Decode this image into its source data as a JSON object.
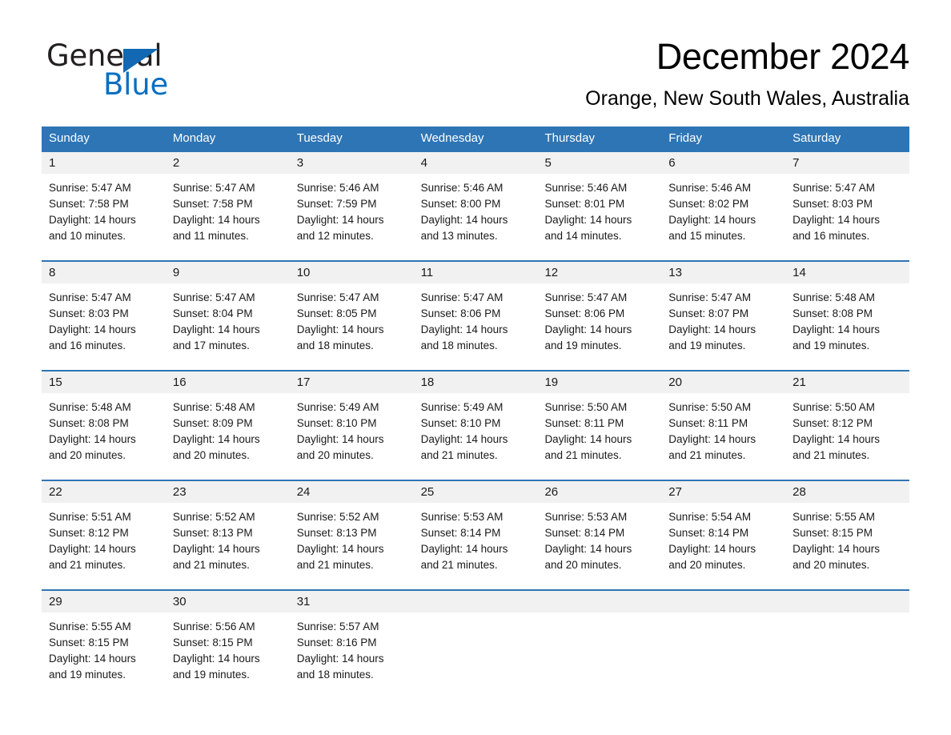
{
  "brand": {
    "name_part1": "General",
    "name_part2": "Blue",
    "triangle_color": "#1268b3",
    "blue_text_color": "#0b6fc0"
  },
  "header": {
    "month_title": "December 2024",
    "location": "Orange, New South Wales, Australia"
  },
  "theme": {
    "header_blue": "#2e75b5",
    "day_band_gray": "#f1f1f1",
    "text_dark": "#1a1a1a"
  },
  "weekdays": [
    "Sunday",
    "Monday",
    "Tuesday",
    "Wednesday",
    "Thursday",
    "Friday",
    "Saturday"
  ],
  "weeks": [
    [
      {
        "day": "1",
        "text": "Sunrise: 5:47 AM\nSunset: 7:58 PM\nDaylight: 14 hours\nand 10 minutes."
      },
      {
        "day": "2",
        "text": "Sunrise: 5:47 AM\nSunset: 7:58 PM\nDaylight: 14 hours\nand 11 minutes."
      },
      {
        "day": "3",
        "text": "Sunrise: 5:46 AM\nSunset: 7:59 PM\nDaylight: 14 hours\nand 12 minutes."
      },
      {
        "day": "4",
        "text": "Sunrise: 5:46 AM\nSunset: 8:00 PM\nDaylight: 14 hours\nand 13 minutes."
      },
      {
        "day": "5",
        "text": "Sunrise: 5:46 AM\nSunset: 8:01 PM\nDaylight: 14 hours\nand 14 minutes."
      },
      {
        "day": "6",
        "text": "Sunrise: 5:46 AM\nSunset: 8:02 PM\nDaylight: 14 hours\nand 15 minutes."
      },
      {
        "day": "7",
        "text": "Sunrise: 5:47 AM\nSunset: 8:03 PM\nDaylight: 14 hours\nand 16 minutes."
      }
    ],
    [
      {
        "day": "8",
        "text": "Sunrise: 5:47 AM\nSunset: 8:03 PM\nDaylight: 14 hours\nand 16 minutes."
      },
      {
        "day": "9",
        "text": "Sunrise: 5:47 AM\nSunset: 8:04 PM\nDaylight: 14 hours\nand 17 minutes."
      },
      {
        "day": "10",
        "text": "Sunrise: 5:47 AM\nSunset: 8:05 PM\nDaylight: 14 hours\nand 18 minutes."
      },
      {
        "day": "11",
        "text": "Sunrise: 5:47 AM\nSunset: 8:06 PM\nDaylight: 14 hours\nand 18 minutes."
      },
      {
        "day": "12",
        "text": "Sunrise: 5:47 AM\nSunset: 8:06 PM\nDaylight: 14 hours\nand 19 minutes."
      },
      {
        "day": "13",
        "text": "Sunrise: 5:47 AM\nSunset: 8:07 PM\nDaylight: 14 hours\nand 19 minutes."
      },
      {
        "day": "14",
        "text": "Sunrise: 5:48 AM\nSunset: 8:08 PM\nDaylight: 14 hours\nand 19 minutes."
      }
    ],
    [
      {
        "day": "15",
        "text": "Sunrise: 5:48 AM\nSunset: 8:08 PM\nDaylight: 14 hours\nand 20 minutes."
      },
      {
        "day": "16",
        "text": "Sunrise: 5:48 AM\nSunset: 8:09 PM\nDaylight: 14 hours\nand 20 minutes."
      },
      {
        "day": "17",
        "text": "Sunrise: 5:49 AM\nSunset: 8:10 PM\nDaylight: 14 hours\nand 20 minutes."
      },
      {
        "day": "18",
        "text": "Sunrise: 5:49 AM\nSunset: 8:10 PM\nDaylight: 14 hours\nand 21 minutes."
      },
      {
        "day": "19",
        "text": "Sunrise: 5:50 AM\nSunset: 8:11 PM\nDaylight: 14 hours\nand 21 minutes."
      },
      {
        "day": "20",
        "text": "Sunrise: 5:50 AM\nSunset: 8:11 PM\nDaylight: 14 hours\nand 21 minutes."
      },
      {
        "day": "21",
        "text": "Sunrise: 5:50 AM\nSunset: 8:12 PM\nDaylight: 14 hours\nand 21 minutes."
      }
    ],
    [
      {
        "day": "22",
        "text": "Sunrise: 5:51 AM\nSunset: 8:12 PM\nDaylight: 14 hours\nand 21 minutes."
      },
      {
        "day": "23",
        "text": "Sunrise: 5:52 AM\nSunset: 8:13 PM\nDaylight: 14 hours\nand 21 minutes."
      },
      {
        "day": "24",
        "text": "Sunrise: 5:52 AM\nSunset: 8:13 PM\nDaylight: 14 hours\nand 21 minutes."
      },
      {
        "day": "25",
        "text": "Sunrise: 5:53 AM\nSunset: 8:14 PM\nDaylight: 14 hours\nand 21 minutes."
      },
      {
        "day": "26",
        "text": "Sunrise: 5:53 AM\nSunset: 8:14 PM\nDaylight: 14 hours\nand 20 minutes."
      },
      {
        "day": "27",
        "text": "Sunrise: 5:54 AM\nSunset: 8:14 PM\nDaylight: 14 hours\nand 20 minutes."
      },
      {
        "day": "28",
        "text": "Sunrise: 5:55 AM\nSunset: 8:15 PM\nDaylight: 14 hours\nand 20 minutes."
      }
    ],
    [
      {
        "day": "29",
        "text": "Sunrise: 5:55 AM\nSunset: 8:15 PM\nDaylight: 14 hours\nand 19 minutes."
      },
      {
        "day": "30",
        "text": "Sunrise: 5:56 AM\nSunset: 8:15 PM\nDaylight: 14 hours\nand 19 minutes."
      },
      {
        "day": "31",
        "text": "Sunrise: 5:57 AM\nSunset: 8:16 PM\nDaylight: 14 hours\nand 18 minutes."
      },
      {
        "day": "",
        "text": ""
      },
      {
        "day": "",
        "text": ""
      },
      {
        "day": "",
        "text": ""
      },
      {
        "day": "",
        "text": ""
      }
    ]
  ]
}
